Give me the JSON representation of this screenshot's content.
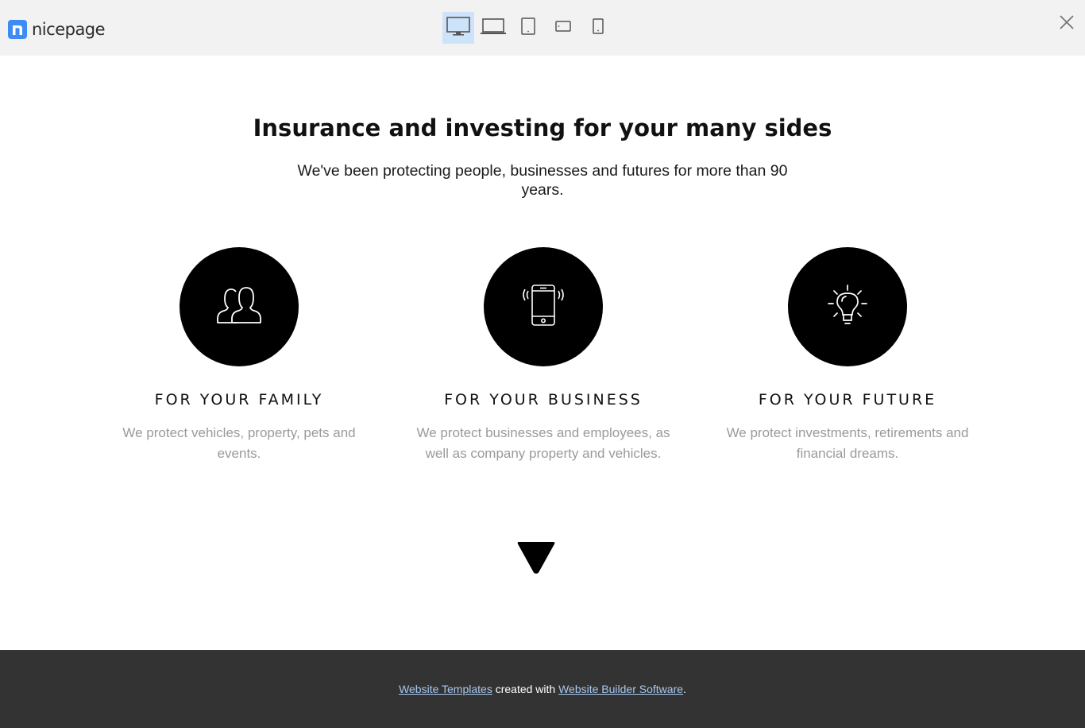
{
  "topbar": {
    "logo_text": "nicepage",
    "logo_icon": "nicepage-logo-icon",
    "devices": [
      {
        "name": "desktop",
        "icon": "desktop-icon",
        "active": true
      },
      {
        "name": "laptop",
        "icon": "laptop-icon",
        "active": false
      },
      {
        "name": "tablet",
        "icon": "tablet-icon",
        "active": false
      },
      {
        "name": "phone-landscape",
        "icon": "phone-landscape-icon",
        "active": false
      },
      {
        "name": "phone-portrait",
        "icon": "phone-portrait-icon",
        "active": false
      }
    ],
    "close_icon": "close-icon"
  },
  "main": {
    "headline": "Insurance and investing for your many sides",
    "subtext": "We've been protecting people, businesses and futures for more than 90 years.",
    "features": [
      {
        "icon": "users-icon",
        "title": "FOR YOUR FAMILY",
        "description": "We protect vehicles, property, pets and events."
      },
      {
        "icon": "smartphone-icon",
        "title": "FOR YOUR BUSINESS",
        "description": "We protect businesses and employees, as well as company property and vehicles."
      },
      {
        "icon": "lightbulb-icon",
        "title": "FOR YOUR FUTURE",
        "description": "We protect investments, retirements and financial dreams."
      }
    ],
    "scroll_icon": "triangle-down-icon"
  },
  "footer": {
    "link1": "Website Templates",
    "middle": " created with ",
    "link2": "Website Builder Software",
    "end": "."
  },
  "colors": {
    "topbar_bg": "#f2f2f2",
    "logo_blue": "#3d8cf5",
    "active_device_bg": "#cde3f9",
    "footer_bg": "#333333",
    "link_color": "#a8c8ee",
    "muted_text": "#9a9a9a"
  }
}
